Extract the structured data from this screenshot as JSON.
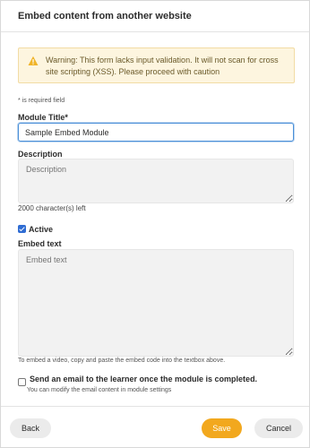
{
  "dialog": {
    "title": "Embed content from another website"
  },
  "warning": {
    "icon": "warning-icon",
    "text": "Warning: This form lacks input validation. It will not scan for cross site scripting (XSS). Please proceed with caution"
  },
  "form": {
    "required_note": "* is required field",
    "module_title_label": "Module Title*",
    "module_title_value": "Sample Embed Module",
    "description_label": "Description",
    "description_placeholder": "Description",
    "chars_left": "2000 character(s) left",
    "active_label": "Active",
    "active_checked": true,
    "embed_label": "Embed text",
    "embed_placeholder": "Embed text",
    "embed_hint": "To embed a video, copy and paste the embed code into the textbox above.",
    "email_label": "Send an email to the learner once the module is completed.",
    "email_checked": false,
    "email_sub": "You can modify the email content in module settings"
  },
  "footer": {
    "back_label": "Back",
    "save_label": "Save",
    "cancel_label": "Cancel"
  },
  "colors": {
    "accent_blue": "#2f6cd3",
    "save_orange": "#f2a81e",
    "warning_bg": "#fdf5df"
  }
}
